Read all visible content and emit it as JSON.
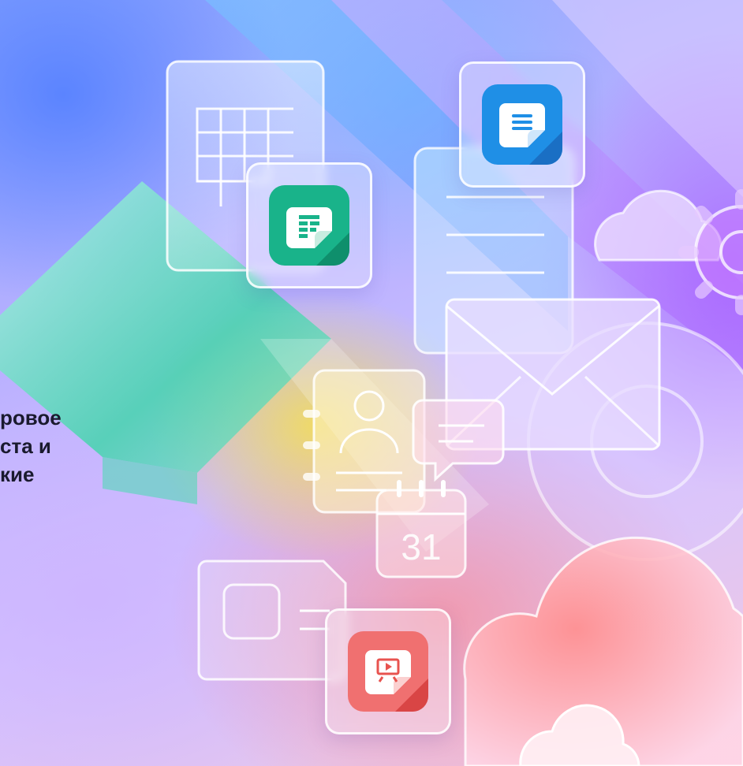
{
  "headline": {
    "lines": [
      "ровое",
      "ста и",
      "кие"
    ]
  },
  "calendar": {
    "day": "31"
  },
  "icons": {
    "spreadsheet_app": "spreadsheet-app-icon",
    "document_app": "document-app-icon",
    "presentation_app": "presentation-app-icon",
    "mail": "envelope-icon",
    "contacts": "contact-book-icon",
    "chat": "chat-bubble-icon",
    "calendar": "calendar-icon",
    "cloud": "cloud-icon",
    "gear": "gear-icon"
  },
  "colors": {
    "spreadsheet_green": "#19b38a",
    "document_blue": "#1f8fe6",
    "presentation_red": "#e8534f",
    "headline_text": "#1a1a2e"
  }
}
